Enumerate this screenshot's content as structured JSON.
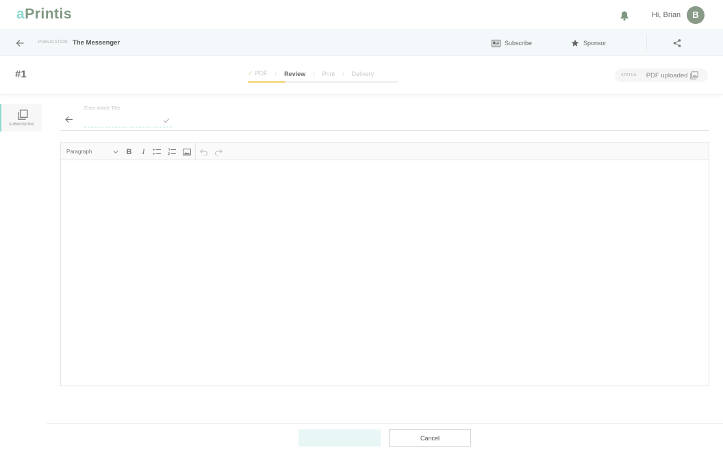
{
  "app": {
    "logo_first": "a",
    "logo_rest": "Printis",
    "greeting": "Hi, Brian",
    "avatar_initial": "B",
    "brand_color": "#8fd9d2",
    "logo_color": "#7f9882"
  },
  "publication": {
    "label": "PUBLICATION",
    "name": "The Messenger",
    "subscribe_label": "Subscribe",
    "sponsor_label": "Sponsor"
  },
  "issue": {
    "number": "#1",
    "steps": [
      {
        "label": "PDF",
        "state": "done"
      },
      {
        "label": "Review",
        "state": "current"
      },
      {
        "label": "Print",
        "state": "pending"
      },
      {
        "label": "Delivery",
        "state": "pending"
      }
    ],
    "progress_fraction": 0.25,
    "status_label": "STATUS",
    "status_value": "PDF uploaded"
  },
  "sidebar": {
    "items": [
      {
        "label": "SUBMISSIONS",
        "icon": "copy-icon"
      }
    ]
  },
  "article": {
    "title_label": "Enter Article Title",
    "title_value": ""
  },
  "editor": {
    "format_select": "Paragraph",
    "tools": [
      "bold-icon",
      "italic-icon",
      "bullet-list-icon",
      "numbered-list-icon",
      "image-icon",
      "undo-icon",
      "redo-icon"
    ]
  },
  "footer": {
    "save_label": "Saved",
    "cancel_label": "Cancel"
  }
}
